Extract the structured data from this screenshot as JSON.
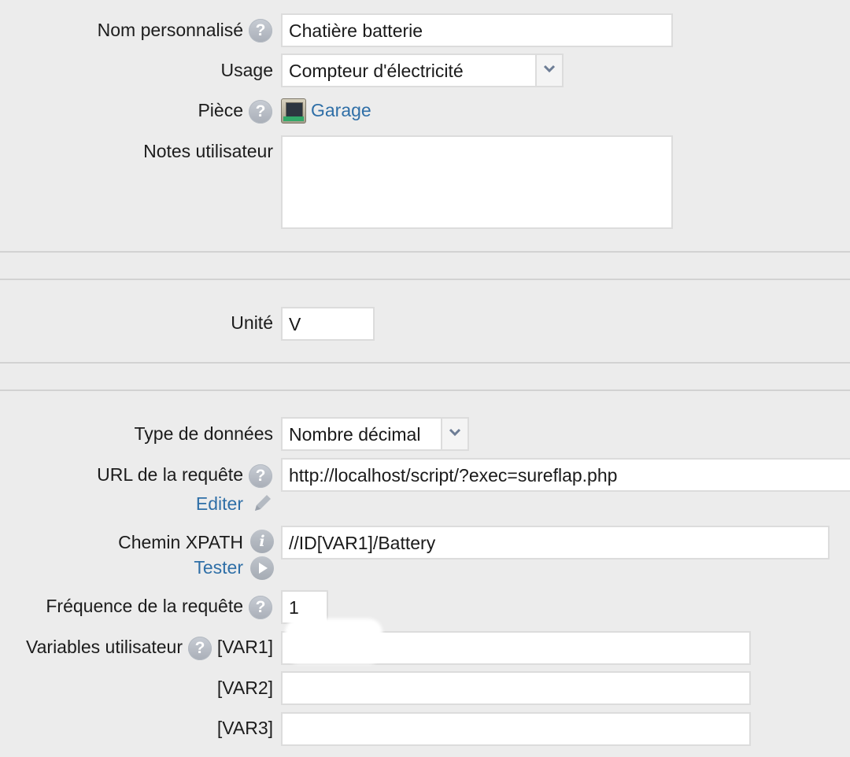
{
  "form": {
    "custom_name": {
      "label": "Nom personnalisé",
      "value": "Chatière batterie"
    },
    "usage": {
      "label": "Usage",
      "value": "Compteur d'électricité"
    },
    "room": {
      "label": "Pièce",
      "value": "Garage"
    },
    "notes": {
      "label": "Notes utilisateur",
      "value": ""
    },
    "unit": {
      "label": "Unité",
      "value": "V"
    },
    "data_type": {
      "label": "Type de données",
      "value": "Nombre décimal"
    },
    "request_url": {
      "label": "URL de la requête",
      "value": "http://localhost/script/?exec=sureflap.php",
      "edit_link": "Editer"
    },
    "xpath": {
      "label": "Chemin XPATH",
      "value": "//ID[VAR1]/Battery",
      "test_link": "Tester"
    },
    "frequency": {
      "label": "Fréquence de la requête",
      "value": "1"
    },
    "user_vars": {
      "label": "Variables utilisateur",
      "vars": [
        {
          "label": "[VAR1]",
          "value": ""
        },
        {
          "label": "[VAR2]",
          "value": ""
        },
        {
          "label": "[VAR3]",
          "value": ""
        }
      ]
    }
  },
  "icons": {
    "help": "?",
    "info": "i",
    "dropdown": "chevron-down-icon",
    "edit": "pencil-icon",
    "test": "play-icon",
    "room": "garage-icon"
  },
  "colors": {
    "link": "#2f6fa7",
    "background": "#ececec"
  }
}
